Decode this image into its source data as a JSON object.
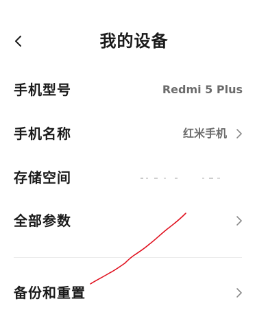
{
  "header": {
    "title": "我的设备"
  },
  "rows": [
    {
      "label": "手机型号",
      "value": "Redmi 5 Plus"
    },
    {
      "label": "手机名称",
      "value": "红米手机"
    },
    {
      "label": "存储空间",
      "value": ""
    },
    {
      "label": "全部参数",
      "value": ""
    },
    {
      "label": "备份和重置",
      "value": ""
    }
  ],
  "icons": {
    "back": "chevron-left-icon",
    "forward": "chevron-right-icon"
  },
  "colors": {
    "background": "#ffffff",
    "text_primary": "#1a1a1a",
    "text_secondary": "#6b6b6b",
    "chevron": "#8a8a8a",
    "divider": "#ececec",
    "annotation_stroke": "#e0101e"
  }
}
